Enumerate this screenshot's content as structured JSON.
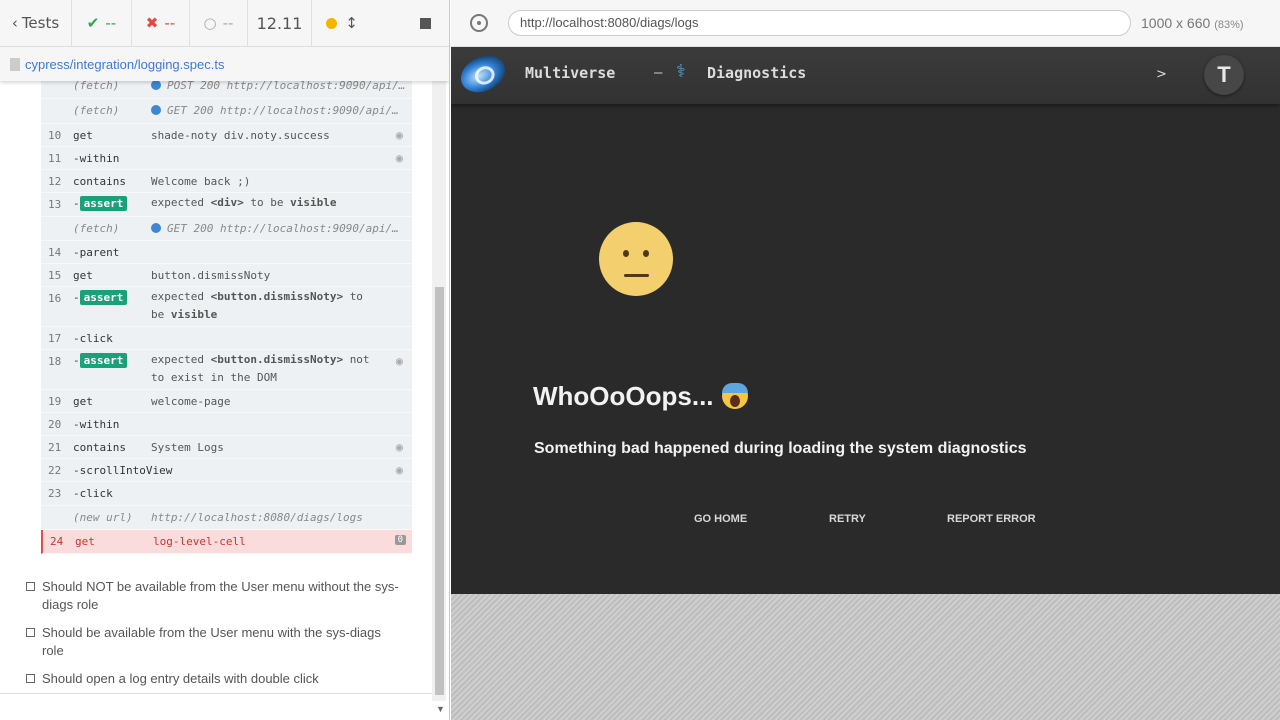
{
  "reporter": {
    "tests_label": "Tests",
    "passed": "--",
    "failed": "--",
    "pending": "--",
    "duration": "12.11",
    "spec_path": "cypress/integration/logging.spec.ts"
  },
  "commands": [
    {
      "num": "",
      "name": "(fetch)",
      "msg": "POST 200 http://localhost:9090/api/…",
      "kind": "fetch"
    },
    {
      "num": "",
      "name": "(fetch)",
      "msg": "GET 200 http://localhost:9090/api/…",
      "kind": "fetch"
    },
    {
      "num": "10",
      "name": "get",
      "msg": "shade-noty div.noty.success"
    },
    {
      "num": "11",
      "name": "-within",
      "msg": ""
    },
    {
      "num": "12",
      "name": "contains",
      "msg": "Welcome back ;)"
    },
    {
      "num": "13",
      "name": "-assert",
      "msg_a": "expected",
      "msg_b": "<div>",
      "msg_c": "to be",
      "msg_d": "visible"
    },
    {
      "num": "",
      "name": "(fetch)",
      "msg": "GET 200 http://localhost:9090/api/…",
      "kind": "fetch"
    },
    {
      "num": "14",
      "name": "-parent",
      "msg": ""
    },
    {
      "num": "15",
      "name": "get",
      "msg": "button.dismissNoty"
    },
    {
      "num": "16",
      "name": "-assert",
      "msg_a": "expected",
      "msg_b": "<button.dismissNoty>",
      "msg_c": "to be",
      "msg_d": "visible"
    },
    {
      "num": "17",
      "name": "-click",
      "msg": ""
    },
    {
      "num": "18",
      "name": "-assert",
      "msg_a": "expected",
      "msg_b": "<button.dismissNoty>",
      "msg_c": "not to exist in the DOM",
      "msg_d": ""
    },
    {
      "num": "19",
      "name": "get",
      "msg": "welcome-page"
    },
    {
      "num": "20",
      "name": "-within",
      "msg": ""
    },
    {
      "num": "21",
      "name": "contains",
      "msg": "System Logs"
    },
    {
      "num": "22",
      "name": "-scrollIntoView",
      "msg": ""
    },
    {
      "num": "23",
      "name": "-click",
      "msg": ""
    },
    {
      "num": "",
      "name": "(new url)",
      "msg": "http://localhost:8080/diags/logs",
      "kind": "fetch"
    },
    {
      "num": "24",
      "name": "get",
      "msg": "log-level-cell",
      "kind": "err",
      "count": "0"
    }
  ],
  "pending_tests": [
    "Should NOT be available from the User menu without the sys-diags role",
    "Should be available from the User menu with the sys-diags role",
    "Should open a log entry details with double click"
  ],
  "browser": {
    "url": "http://localhost:8080/diags/logs",
    "viewport": "1000 x 660",
    "scale": "(83%)"
  },
  "app": {
    "brand": "Multiverse",
    "separator": "–",
    "page": "Diagnostics",
    "chevron": ">",
    "avatar": "T",
    "error_title": "WhoOoOops...",
    "error_message": "Something bad happened during loading the system diagnostics",
    "actions": [
      "GO HOME",
      "RETRY",
      "REPORT ERROR"
    ]
  }
}
